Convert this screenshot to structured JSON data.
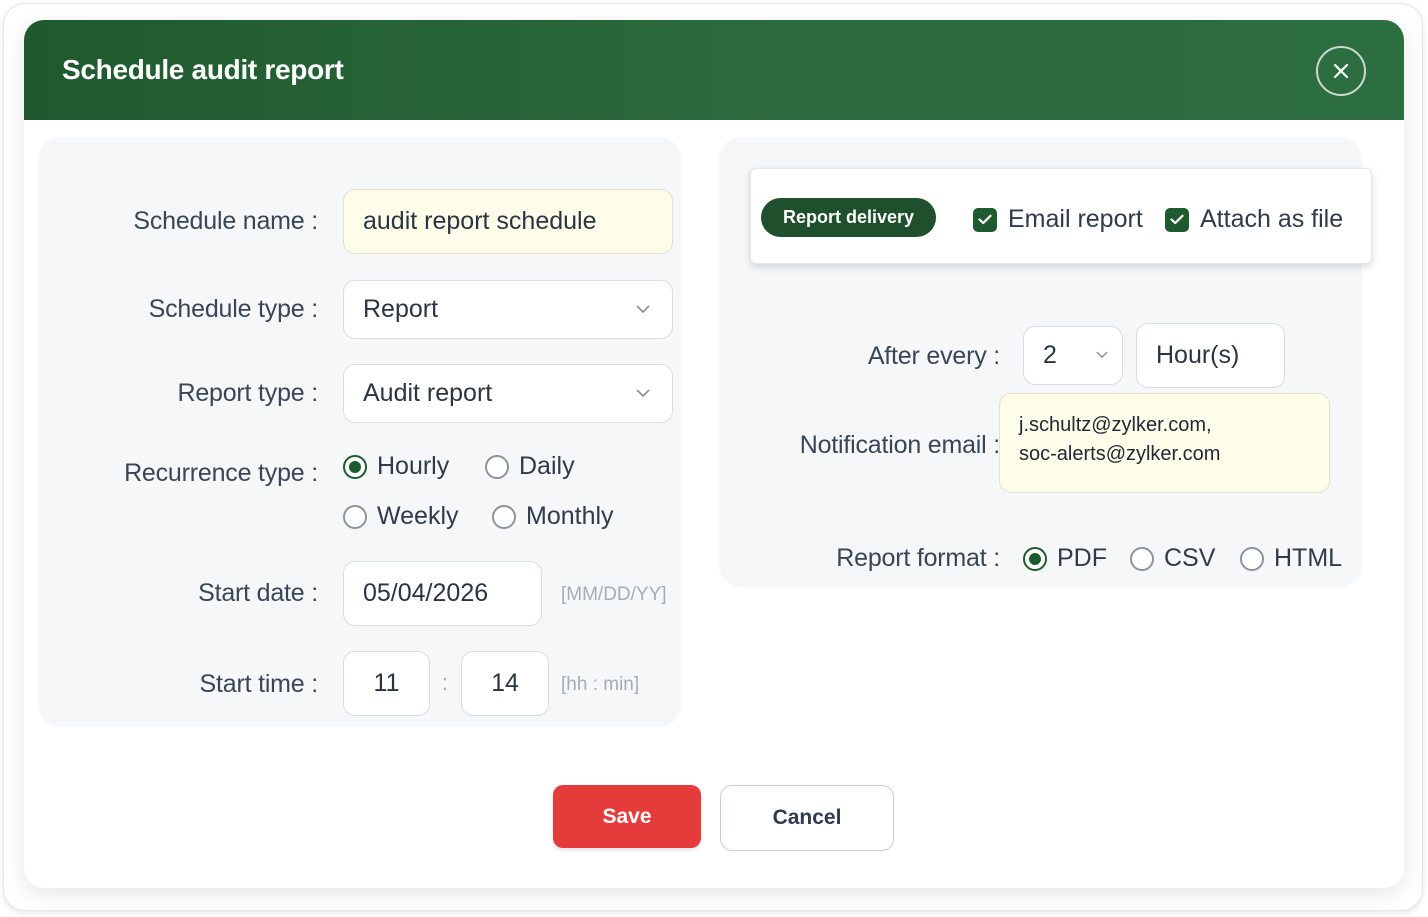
{
  "dialog": {
    "title": "Schedule audit report",
    "close_icon": "close-icon"
  },
  "form": {
    "schedule_name": {
      "label": "Schedule name :",
      "value": "audit report schedule"
    },
    "schedule_type": {
      "label": "Schedule type :",
      "value": "Report"
    },
    "report_type": {
      "label": "Report type :",
      "value": "Audit report"
    },
    "recurrence_type": {
      "label": "Recurrence type :",
      "options": [
        "Hourly",
        "Daily",
        "Weekly",
        "Monthly"
      ],
      "selected": "Hourly"
    },
    "start_date": {
      "label": "Start date :",
      "value": "05/04/2026",
      "hint": "[MM/DD/YY]"
    },
    "start_time": {
      "label": "Start time :",
      "hour": "11",
      "separator": ":",
      "minute": "14",
      "hint": "[hh : min]"
    }
  },
  "delivery": {
    "tab_label": "Report delivery",
    "email_report": {
      "label": "Email report",
      "checked": true
    },
    "attach_as_file": {
      "label": "Attach as file",
      "checked": true
    },
    "after_every": {
      "label": "After every :",
      "value": "2",
      "unit": "Hour(s)"
    },
    "notification_email": {
      "label": "Notification email :",
      "line1": "j.schultz@zylker.com,",
      "line2": "soc-alerts@zylker.com"
    },
    "report_format": {
      "label": "Report format :",
      "options": [
        "PDF",
        "CSV",
        "HTML"
      ],
      "selected": "PDF"
    }
  },
  "actions": {
    "save": "Save",
    "cancel": "Cancel"
  },
  "colors": {
    "header_green": "#1f5a2e",
    "save_red": "#e53b3b",
    "field_yellow": "#fdfde9"
  }
}
